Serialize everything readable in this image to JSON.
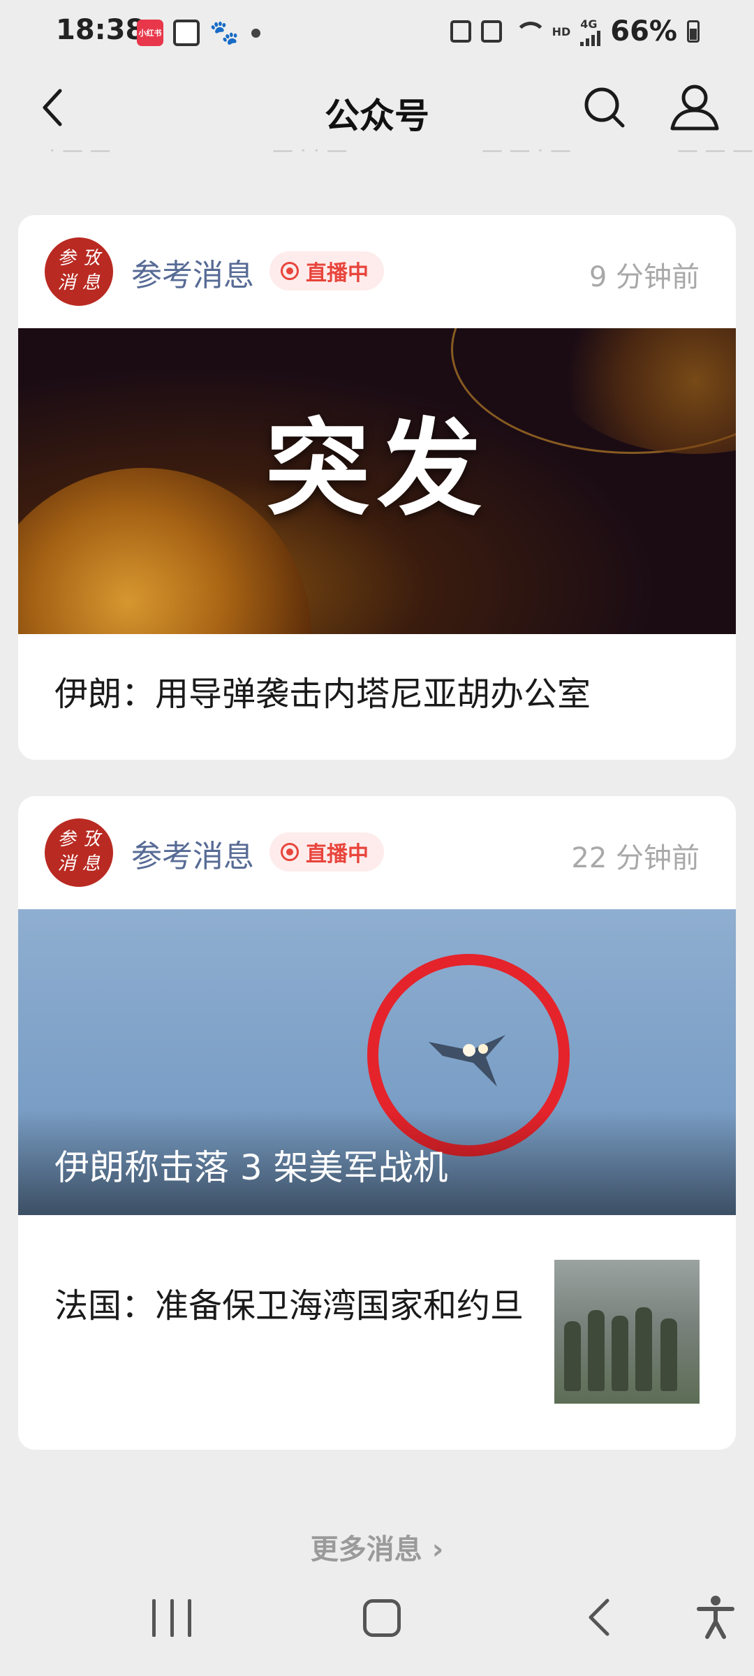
{
  "status_bar": {
    "time": "18:38",
    "battery": "66%",
    "network_small": "HD",
    "signal_label": "4G",
    "notif_app_label": "小红书"
  },
  "nav": {
    "title": "公众号"
  },
  "peek_row": [
    "·  —  —",
    "— · · —",
    "— — · —",
    "— — —"
  ],
  "cards": [
    {
      "account": "参考消息",
      "live_label": "直播中",
      "time_ago": "9 分钟前",
      "banner_text": "突发",
      "title": "伊朗：用导弹袭击内塔尼亚胡办公室"
    },
    {
      "account": "参考消息",
      "live_label": "直播中",
      "time_ago": "22 分钟前",
      "banner_caption": "伊朗称击落 3 架美军战机",
      "item_title": "法国：准备保卫海湾国家和约旦"
    }
  ],
  "avatar_glyphs": [
    "参",
    "攷",
    "消",
    "息"
  ],
  "more_link": "更多消息 ›",
  "colors": {
    "account_blue": "#576b95",
    "live_red": "#e8453c",
    "avatar_red": "#b92a22",
    "background": "#ededed"
  },
  "icons": [
    "back-arrow-icon",
    "search-icon",
    "profile-icon",
    "live-dot-icon",
    "recent-apps-icon",
    "home-icon",
    "back-icon",
    "accessibility-icon"
  ]
}
